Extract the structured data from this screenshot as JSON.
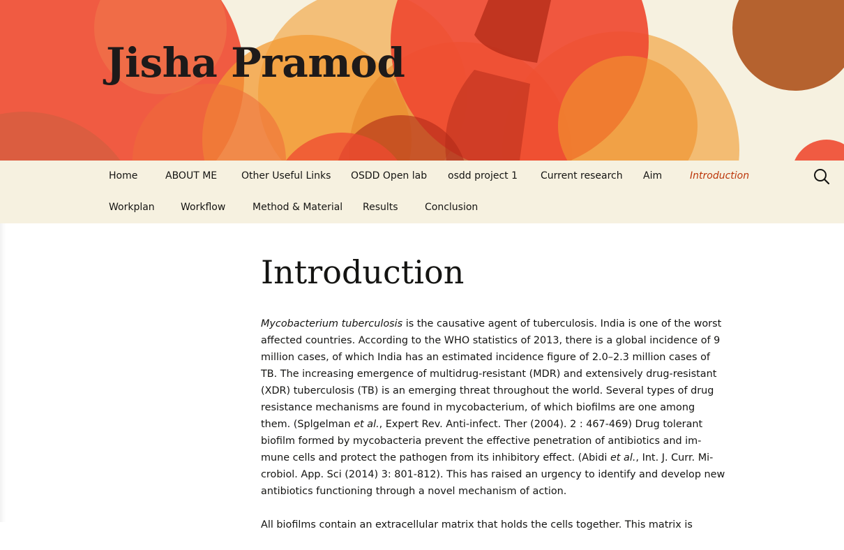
{
  "site": {
    "title": "Jisha Pramod"
  },
  "colors": {
    "header_background": "#f6f1e0",
    "nav_background": "#f6f1e0",
    "nav_current": "#bc360a",
    "text": "#141412",
    "circle_red": "#ef4a31",
    "circle_orange": "#f0922e",
    "circle_light_orange": "#f2b35f",
    "circle_brown": "#b5622f",
    "circle_dark_red": "#b12a17"
  },
  "nav": {
    "row1": [
      {
        "label": "Home"
      },
      {
        "label": "ABOUT ME"
      },
      {
        "label": "Other Useful Links"
      },
      {
        "label": "OSDD Open lab"
      },
      {
        "label": "osdd project 1"
      },
      {
        "label": "Current research"
      },
      {
        "label": "Aim"
      },
      {
        "label": "Introduction",
        "current": true
      }
    ],
    "row2": [
      {
        "label": "Workplan"
      },
      {
        "label": "Workflow"
      },
      {
        "label": "Method & Material"
      },
      {
        "label": "Results"
      },
      {
        "label": "Conclusion"
      }
    ],
    "search_icon": "search-icon"
  },
  "entry": {
    "title": "Introduction",
    "paragraph1": {
      "lines": [
        {
          "italic": "Mycobacterium tuberculosis",
          "text": " is the causative agent of tuberculosis. India is one of the worst"
        },
        {
          "text": "affected countries. According to the WHO statistics of 2013, there is a global incidence of 9"
        },
        {
          "text": "million cases, of which India has an estimated incidence figure of 2.0–2.3 million cases of"
        },
        {
          "text": "TB. The increasing emergence of multidrug-resistant (MDR) and extensively drug-resistant"
        },
        {
          "text": "(XDR) tuberculosis (TB) is an emerging threat throughout the world. Several types of drug"
        },
        {
          "text": "resistance mechanisms are found in mycobacterium, of which biofilms are one among"
        },
        {
          "pre": "them. (Splgelman ",
          "italic": "et al.",
          "text": ", Expert Rev. Anti-infect. Ther  (2004).  2 :  467-469) Drug tolerant"
        },
        {
          "text": "biofilm formed by mycobacteria prevent the effective penetration of antibiotics and im-"
        },
        {
          "pre": "mune cells and protect the pathogen from its inhibitory effect. (Abidi ",
          "italic": "et al.",
          "text": ", Int. J. Curr. Mi-"
        },
        {
          "text": "crobiol. App. Sci (2014) 3: 801-812). This has raised an urgency to identify and develop new"
        },
        {
          "text": "antibiotics functioning through a novel mechanism of action."
        }
      ]
    },
    "paragraph2_partial": "All biofilms contain an extracellular matrix that holds the cells together. This matrix is"
  }
}
